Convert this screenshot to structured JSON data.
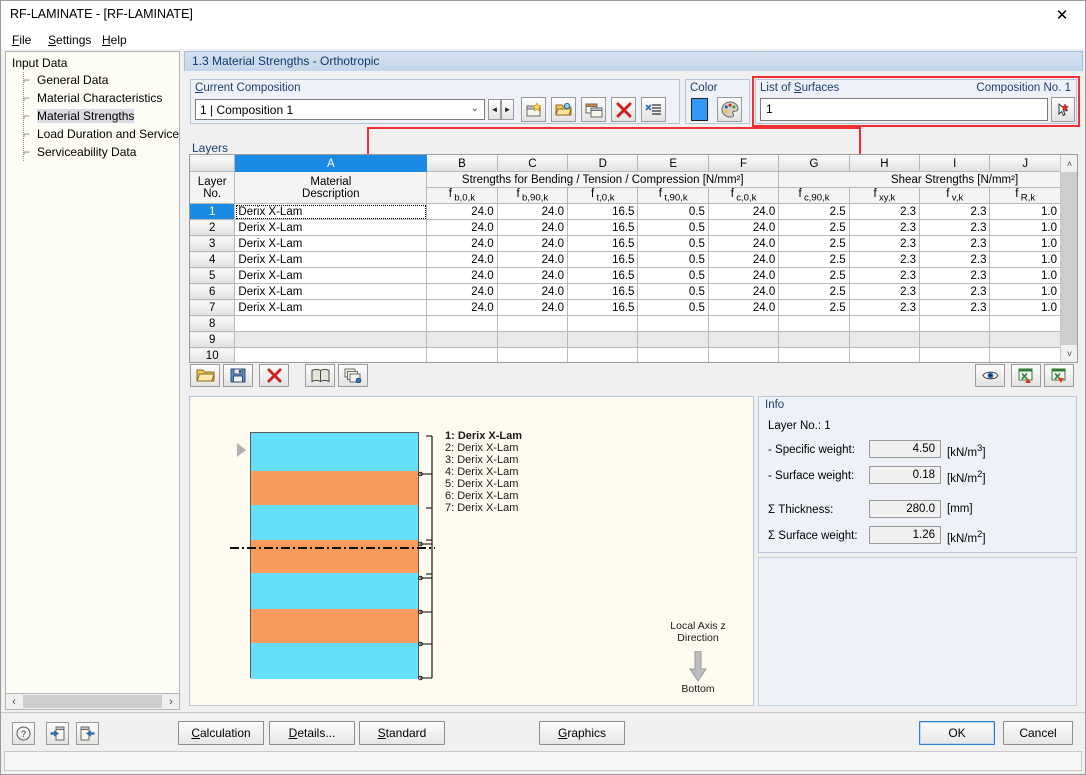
{
  "window": {
    "title": "RF-LAMINATE - [RF-LAMINATE]",
    "close_label": "✕"
  },
  "menu": [
    {
      "label": "File",
      "accel": "F"
    },
    {
      "label": "Settings",
      "accel": "S"
    },
    {
      "label": "Help",
      "accel": "H"
    }
  ],
  "sidebar": {
    "root": "Input Data",
    "items": [
      {
        "label": "General Data",
        "selected": false
      },
      {
        "label": "Material Characteristics",
        "selected": false
      },
      {
        "label": "Material Strengths",
        "selected": true
      },
      {
        "label": "Load Duration and Service Clas",
        "selected": false
      },
      {
        "label": "Serviceability Data",
        "selected": false
      }
    ],
    "scroll_left": "‹",
    "scroll_right": "›"
  },
  "pane": {
    "header": "1.3 Material Strengths - Orthotropic"
  },
  "composition": {
    "group_title": "Current Composition",
    "group_title_accel": "C",
    "value": "1 | Composition 1",
    "dropdown_arrow": "⌵",
    "nav_prev": "◄",
    "nav_next": "►",
    "buttons": [
      {
        "name": "new-composition-button",
        "icon": "new-window-icon"
      },
      {
        "name": "edit-composition-button",
        "icon": "open-folder-icon"
      },
      {
        "name": "copy-composition-button",
        "icon": "copy-window-icon"
      },
      {
        "name": "delete-composition-button",
        "icon": "red-x-icon"
      },
      {
        "name": "list-composition-button",
        "icon": "list-delete-icon"
      }
    ]
  },
  "color": {
    "group_title": "Color",
    "swatch_hex": "#3399f5",
    "palette_button": "palette-icon"
  },
  "surfaces": {
    "group_title": "List of Surfaces",
    "group_title_accel": "S",
    "composition_no_label": "Composition No. 1",
    "value": "1",
    "pick_button": "pick-surface-icon"
  },
  "layers_panel": {
    "title": "Layers"
  },
  "table": {
    "column_letters": [
      "",
      "A",
      "B",
      "C",
      "D",
      "E",
      "F",
      "G",
      "H",
      "I",
      "J"
    ],
    "active_column": "A",
    "row_header_lines": [
      "Layer",
      "No."
    ],
    "material_header_lines": [
      "Material",
      "Description"
    ],
    "group_headers": [
      {
        "label": "Strengths for Bending / Tension / Compression [N/mm²]",
        "span": 5
      },
      {
        "label": "Shear Strengths [N/mm²]",
        "span": 3
      }
    ],
    "sub_headers": [
      {
        "base": "f",
        "sub": "b,0,k"
      },
      {
        "base": "f",
        "sub": "b,90,k"
      },
      {
        "base": "f",
        "sub": "t,0,k"
      },
      {
        "base": "f",
        "sub": "t,90,k"
      },
      {
        "base": "f",
        "sub": "c,0,k"
      },
      {
        "base": "f",
        "sub": "c,90,k"
      },
      {
        "base": "f",
        "sub": "xy,k"
      },
      {
        "base": "f",
        "sub": "v,k"
      },
      {
        "base": "f",
        "sub": "R,k"
      }
    ],
    "rows": [
      {
        "no": "1",
        "material": "Derix X-Lam",
        "values": [
          "24.0",
          "24.0",
          "16.5",
          "0.5",
          "24.0",
          "2.5",
          "2.3",
          "2.3",
          "1.0"
        ],
        "selected": true,
        "shaded": false
      },
      {
        "no": "2",
        "material": "Derix X-Lam",
        "values": [
          "24.0",
          "24.0",
          "16.5",
          "0.5",
          "24.0",
          "2.5",
          "2.3",
          "2.3",
          "1.0"
        ],
        "selected": false,
        "shaded": false
      },
      {
        "no": "3",
        "material": "Derix X-Lam",
        "values": [
          "24.0",
          "24.0",
          "16.5",
          "0.5",
          "24.0",
          "2.5",
          "2.3",
          "2.3",
          "1.0"
        ],
        "selected": false,
        "shaded": false
      },
      {
        "no": "4",
        "material": "Derix X-Lam",
        "values": [
          "24.0",
          "24.0",
          "16.5",
          "0.5",
          "24.0",
          "2.5",
          "2.3",
          "2.3",
          "1.0"
        ],
        "selected": false,
        "shaded": false
      },
      {
        "no": "5",
        "material": "Derix X-Lam",
        "values": [
          "24.0",
          "24.0",
          "16.5",
          "0.5",
          "24.0",
          "2.5",
          "2.3",
          "2.3",
          "1.0"
        ],
        "selected": false,
        "shaded": false
      },
      {
        "no": "6",
        "material": "Derix X-Lam",
        "values": [
          "24.0",
          "24.0",
          "16.5",
          "0.5",
          "24.0",
          "2.5",
          "2.3",
          "2.3",
          "1.0"
        ],
        "selected": false,
        "shaded": false
      },
      {
        "no": "7",
        "material": "Derix X-Lam",
        "values": [
          "24.0",
          "24.0",
          "16.5",
          "0.5",
          "24.0",
          "2.5",
          "2.3",
          "2.3",
          "1.0"
        ],
        "selected": false,
        "shaded": false
      },
      {
        "no": "8",
        "material": "",
        "values": [
          "",
          "",
          "",
          "",
          "",
          "",
          "",
          "",
          ""
        ],
        "selected": false,
        "shaded": false
      },
      {
        "no": "9",
        "material": "",
        "values": [
          "",
          "",
          "",
          "",
          "",
          "",
          "",
          "",
          ""
        ],
        "selected": false,
        "shaded": true
      },
      {
        "no": "10",
        "material": "",
        "values": [
          "",
          "",
          "",
          "",
          "",
          "",
          "",
          "",
          ""
        ],
        "selected": false,
        "shaded": false
      }
    ],
    "scroll_up": "˄",
    "scroll_down": "˅"
  },
  "table_toolbar": {
    "left": [
      {
        "name": "import-layers-button",
        "icon": "open-folder-icon"
      },
      {
        "name": "save-layers-button",
        "icon": "floppy-disk-icon"
      },
      {
        "name": "delete-layer-button",
        "icon": "red-x-icon"
      },
      {
        "name": "material-library-button",
        "icon": "book-icon"
      },
      {
        "name": "duplicate-layer-button",
        "icon": "copy-layers-icon"
      }
    ],
    "right": [
      {
        "name": "view-mode-button",
        "icon": "eye-icon"
      },
      {
        "name": "export-excel-up-button",
        "icon": "excel-export-icon"
      },
      {
        "name": "export-excel-down-button",
        "icon": "excel-import-icon"
      }
    ]
  },
  "graphic": {
    "layers": [
      {
        "index": 1,
        "label": "1: Derix X-Lam",
        "color": "#66e0fa"
      },
      {
        "index": 2,
        "label": "2: Derix X-Lam",
        "color": "#f89b5c"
      },
      {
        "index": 3,
        "label": "3: Derix X-Lam",
        "color": "#66e0fa"
      },
      {
        "index": 4,
        "label": "4: Derix X-Lam",
        "color": "#f89b5c"
      },
      {
        "index": 5,
        "label": "5: Derix X-Lam",
        "color": "#66e0fa"
      },
      {
        "index": 6,
        "label": "6: Derix X-Lam",
        "color": "#f89b5c"
      },
      {
        "index": 7,
        "label": "7: Derix X-Lam",
        "color": "#66e0fa"
      }
    ],
    "axis_note_line1": "Local Axis z",
    "axis_note_line2": "Direction",
    "axis_note_bottom": "Bottom",
    "arrow_icon": "down-arrow-icon"
  },
  "info": {
    "title": "Info",
    "layer_no": "Layer No.: 1",
    "rows": [
      {
        "label": "- Specific weight:",
        "value": "4.50",
        "unit_base": "[kN/m",
        "unit_sup": "3",
        "unit_end": "]"
      },
      {
        "label": "- Surface weight:",
        "value": "0.18",
        "unit_base": "[kN/m",
        "unit_sup": "2",
        "unit_end": "]"
      },
      {
        "label": "Σ Thickness:",
        "value": "280.0",
        "unit_base": "[mm",
        "unit_sup": "",
        "unit_end": "]"
      },
      {
        "label": "Σ Surface weight:",
        "value": "1.26",
        "unit_base": "[kN/m",
        "unit_sup": "2",
        "unit_end": "]"
      }
    ]
  },
  "bottom": {
    "icon_buttons": [
      {
        "name": "help-button",
        "icon": "question-mark-icon"
      },
      {
        "name": "prev-module-button",
        "icon": "back-arrow-icon"
      },
      {
        "name": "next-module-button",
        "icon": "forward-arrow-icon"
      }
    ],
    "buttons": [
      {
        "name": "calculation-button",
        "label": "Calculation",
        "accel": "C",
        "default": false
      },
      {
        "name": "details-button",
        "label": "Details...",
        "accel": "D",
        "default": false
      },
      {
        "name": "standard-button",
        "label": "Standard",
        "accel": "S",
        "default": false
      },
      {
        "name": "graphics-button",
        "label": "Graphics",
        "accel": "G",
        "default": false
      }
    ],
    "ok_label": "OK",
    "cancel_label": "Cancel"
  }
}
